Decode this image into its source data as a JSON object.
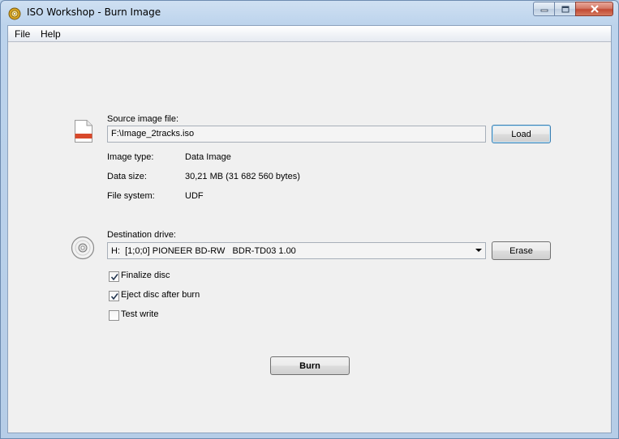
{
  "window": {
    "title": "ISO Workshop - Burn Image"
  },
  "menu": {
    "file": "File",
    "help": "Help"
  },
  "source": {
    "label": "Source image file:",
    "path": "F:\\Image_2tracks.iso",
    "load_button": "Load",
    "info": [
      {
        "label": "Image type:",
        "value": "Data Image"
      },
      {
        "label": "Data size:",
        "value": "30,21 MB (31 682 560 bytes)"
      },
      {
        "label": "File system:",
        "value": "UDF"
      }
    ]
  },
  "destination": {
    "label": "Destination drive:",
    "selected_drive": "H:  [1;0;0] PIONEER BD-RW   BDR-TD03 1.00",
    "erase_button": "Erase"
  },
  "options": [
    {
      "label": "Finalize disc",
      "checked": true
    },
    {
      "label": "Eject disc after burn",
      "checked": true
    },
    {
      "label": "Test write",
      "checked": false
    }
  ],
  "burn_button": "Burn",
  "icons": {
    "app": "iso-workshop-app-icon",
    "file": "document-file-icon",
    "disc": "optical-disc-icon"
  }
}
